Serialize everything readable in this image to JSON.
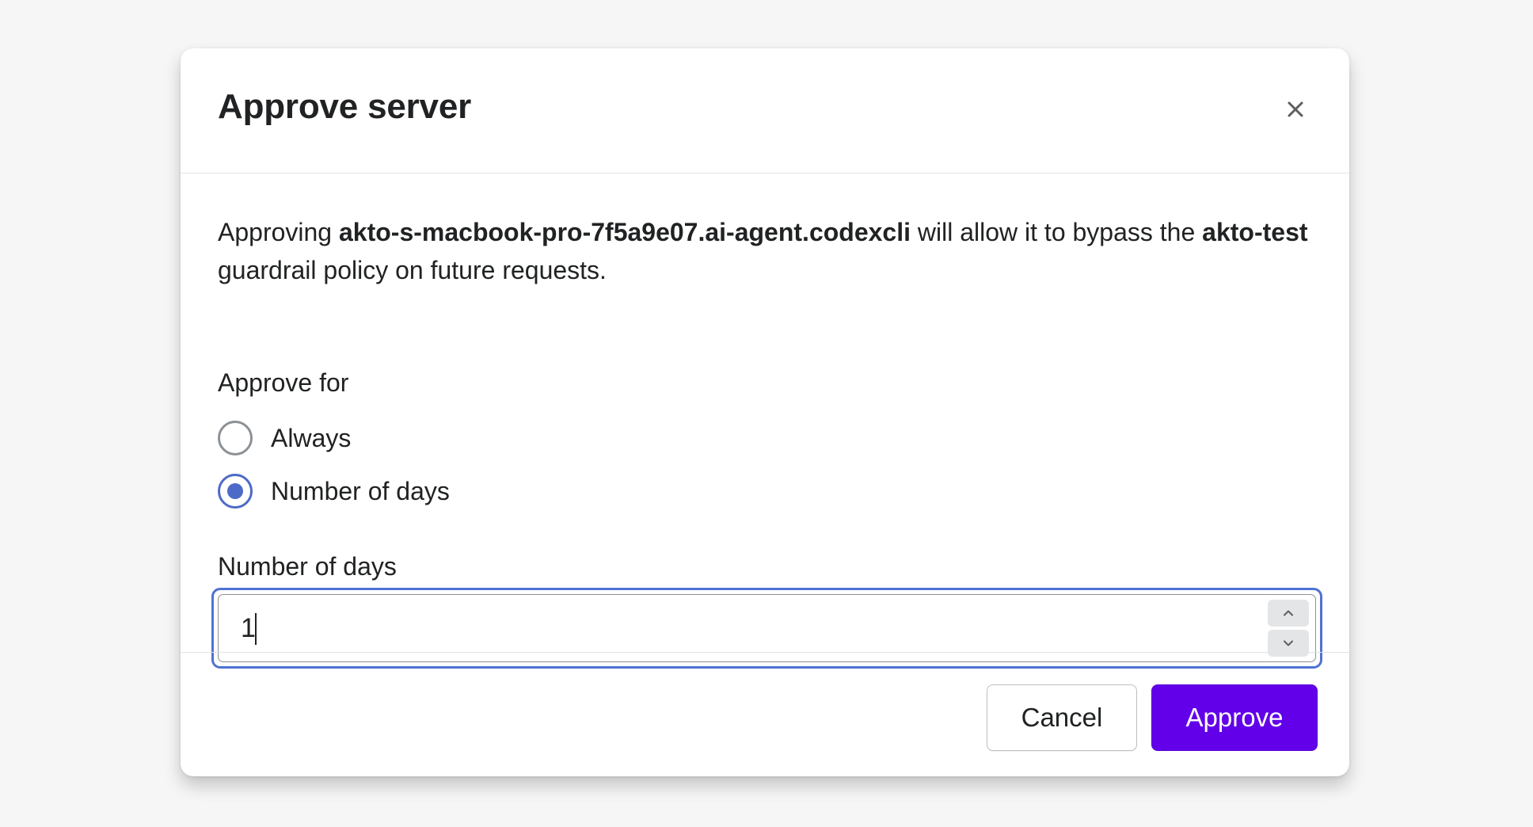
{
  "modal": {
    "title": "Approve server",
    "close_icon": "close-icon"
  },
  "description": {
    "prefix": "Approving ",
    "server_name": "akto-s-macbook-pro-7f5a9e07.ai-agent.codexcli",
    "middle": " will allow it to bypass the ",
    "policy_name": "akto-test",
    "suffix": " guardrail policy on future requests."
  },
  "approve_for": {
    "label": "Approve for",
    "options": [
      {
        "label": "Always",
        "checked": false
      },
      {
        "label": "Number of days",
        "checked": true
      }
    ]
  },
  "days_field": {
    "label": "Number of days",
    "value": "1",
    "increment_icon": "chevron-up-icon",
    "decrement_icon": "chevron-down-icon"
  },
  "footer": {
    "cancel_label": "Cancel",
    "approve_label": "Approve"
  },
  "colors": {
    "primary": "#6200ea",
    "focus_ring": "#4f72d3",
    "radio_selected": "#4c6ac7"
  }
}
